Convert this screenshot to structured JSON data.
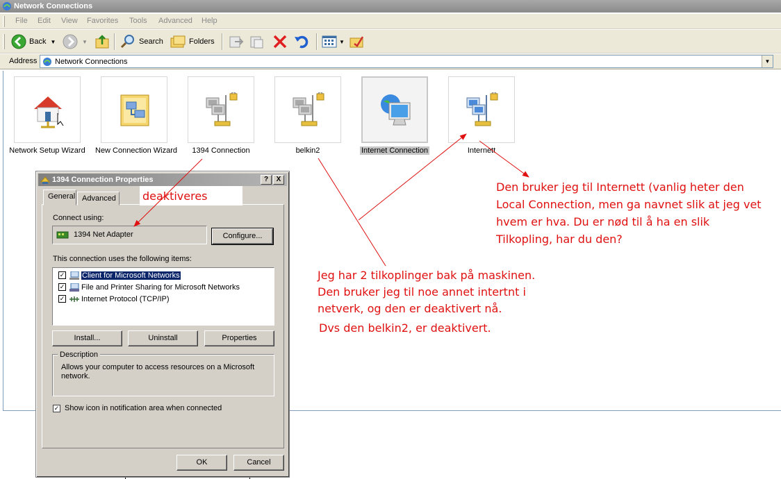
{
  "window": {
    "title": "Network Connections"
  },
  "menu": [
    "File",
    "Edit",
    "View",
    "Favorites",
    "Tools",
    "Advanced",
    "Help"
  ],
  "toolbar": {
    "back": "Back",
    "search": "Search",
    "folders": "Folders"
  },
  "address": {
    "label": "Address",
    "value": "Network Connections"
  },
  "connections": [
    {
      "name": "Network Setup Wizard",
      "icon": "network-setup-wizard-icon"
    },
    {
      "name": "New Connection Wizard",
      "icon": "new-connection-wizard-icon"
    },
    {
      "name": "1394 Connection",
      "icon": "lan-connection-icon"
    },
    {
      "name": "belkin2",
      "icon": "lan-connection-icon"
    },
    {
      "name": "Internet Connection",
      "icon": "internet-connection-icon",
      "selected": true
    },
    {
      "name": "Internett",
      "icon": "lan-connection-icon"
    }
  ],
  "dialog": {
    "title": "1394 Connection Properties",
    "help_btn": "?",
    "close_btn": "X",
    "tabs": [
      "General",
      "Advanced"
    ],
    "connect_using_label": "Connect using:",
    "adapter": "1394 Net Adapter",
    "configure_btn": "Configure...",
    "items_label": "This connection uses the following items:",
    "items": [
      {
        "label": "Client for Microsoft Networks",
        "checked": true,
        "selected": true
      },
      {
        "label": "File and Printer Sharing for Microsoft Networks",
        "checked": true
      },
      {
        "label": "Internet Protocol (TCP/IP)",
        "checked": true
      }
    ],
    "install_btn": "Install...",
    "uninstall_btn": "Uninstall",
    "properties_btn": "Properties",
    "description_label": "Description",
    "description_line1": "Allows your computer to access resources on a Microsoft",
    "description_line2": "network.",
    "show_icon_label": "Show icon in notification area when connected",
    "show_icon_checked": true,
    "ok_btn": "OK",
    "cancel_btn": "Cancel"
  },
  "annotations": {
    "deaktiveres": "deaktiveres",
    "internett_note": [
      "Den bruker jeg til Internett (vanlig heter den",
      "Local Connection, men ga navnet slik at jeg vet",
      "hvem er hva. Du er nød til å ha en slik",
      "Tilkopling, har du den?"
    ],
    "belkin_note": [
      "Jeg har 2 tilkoplinger bak på maskinen.",
      "Den bruker jeg til noe annet intertnt i",
      "netverk, og den er deaktivert nå."
    ],
    "belkin_note2": "Dvs den belkin2, er deaktivert.",
    "accent_color": "#e01010"
  }
}
